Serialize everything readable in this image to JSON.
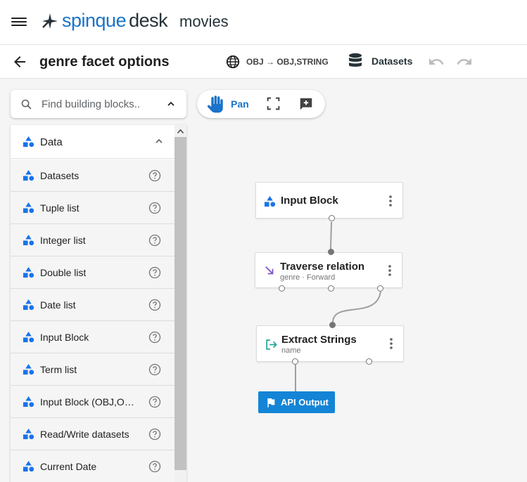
{
  "app": {
    "brand_prefix": "spinque",
    "brand_suffix": "desk",
    "workspace": "movies"
  },
  "toolbar": {
    "title": "genre facet options",
    "type_signature": "OBJ → OBJ,STRING",
    "datasets_label": "Datasets"
  },
  "search": {
    "placeholder": "Find building blocks.."
  },
  "block_panel": {
    "category": "Data",
    "items": [
      {
        "label": "Datasets"
      },
      {
        "label": "Tuple list"
      },
      {
        "label": "Integer list"
      },
      {
        "label": "Double list"
      },
      {
        "label": "Date list"
      },
      {
        "label": "Input Block"
      },
      {
        "label": "Term list"
      },
      {
        "label": "Input Block (OBJ,OBJ)"
      },
      {
        "label": "Read/Write datasets"
      },
      {
        "label": "Current Date"
      }
    ]
  },
  "canvas_tools": {
    "pan_label": "Pan"
  },
  "graph": {
    "nodes": [
      {
        "title": "Input Block",
        "subtitle": ""
      },
      {
        "title": "Traverse relation",
        "subtitle": "genre · Forward"
      },
      {
        "title": "Extract Strings",
        "subtitle": "name"
      }
    ],
    "output_label": "API Output"
  },
  "colors": {
    "brand": "#1a73c9",
    "output": "#1484d6",
    "block_icon": "#1a73e8",
    "traverse_icon": "#7e57c2",
    "extract_icon": "#26a69a"
  },
  "icons": {
    "menu": "hamburger-menu-icon",
    "back": "arrow-left-icon",
    "globe": "globe-icon",
    "database": "database-icon",
    "undo": "undo-icon",
    "redo": "redo-icon",
    "search": "search-icon",
    "pan": "hand-icon",
    "fit": "fullscreen-icon",
    "note": "add-comment-icon",
    "help": "help-circle-icon",
    "block": "shapes-icon"
  }
}
